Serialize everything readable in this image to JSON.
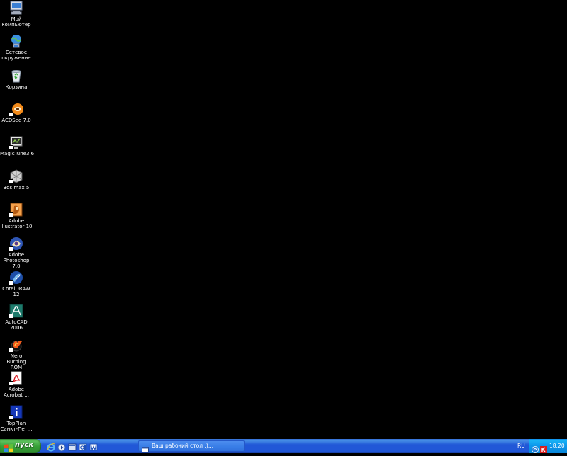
{
  "desktop": {
    "icons": [
      {
        "label": "Мой\nкомпьютер",
        "icon": "my-computer-icon"
      },
      {
        "label": "Сетевое\nокружение",
        "icon": "network-places-icon"
      },
      {
        "label": "Корзина",
        "icon": "recycle-bin-icon"
      },
      {
        "label": "ACDSee 7.0",
        "icon": "acdsee-icon"
      },
      {
        "label": "MagicTune3.6",
        "icon": "magictune-icon"
      },
      {
        "label": "3ds max 5",
        "icon": "3ds-max-icon"
      },
      {
        "label": "Adobe\nIllustrator 10",
        "icon": "illustrator-icon"
      },
      {
        "label": "Adobe\nPhotoshop 7.0",
        "icon": "photoshop-icon"
      },
      {
        "label": "CorelDRAW 12",
        "icon": "coreldraw-icon"
      },
      {
        "label": "AutoCAD 2006",
        "icon": "autocad-icon"
      },
      {
        "label": "Nero Burning\nROM",
        "icon": "nero-icon"
      },
      {
        "label": "Adobe\nAcrobat ...",
        "icon": "acrobat-icon"
      },
      {
        "label": "TopPlan\nСанкт-Пет...",
        "icon": "topplan-icon"
      }
    ]
  },
  "taskbar": {
    "start_label": "пуск",
    "quicklaunch": [
      "ie-icon",
      "media-player-icon",
      "show-desktop-icon",
      "outlook-icon",
      "word-icon"
    ],
    "task_label": "Ваш рабочий стол :)...",
    "language": "RU",
    "clock": "18:20"
  },
  "colors": {
    "desktop_bg": "#000000",
    "taskbar_blue": "#2157d7",
    "start_green": "#369e36",
    "tray_blue": "#0c98ec"
  }
}
